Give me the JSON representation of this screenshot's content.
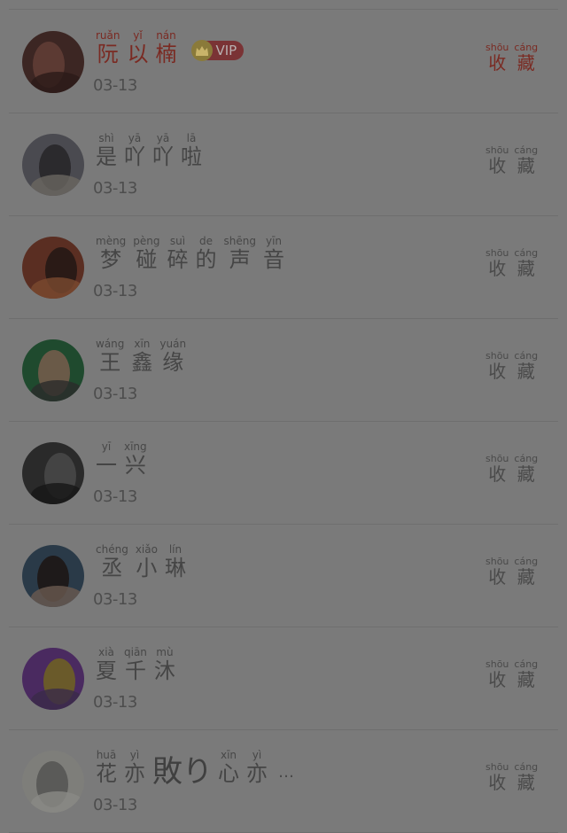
{
  "collect_label": {
    "chars": [
      "收",
      "藏"
    ],
    "pinyin": [
      "shōu",
      "cáng"
    ]
  },
  "vip_label": "VIP",
  "users": [
    {
      "chars": [
        "阮",
        "以",
        "楠"
      ],
      "pinyin": [
        "ruǎn",
        "yǐ",
        "nán"
      ],
      "date": "03-13",
      "vip": true,
      "avatar_colors": [
        "#3c2623",
        "#5c3a33",
        "#2a1a18"
      ]
    },
    {
      "chars": [
        "是",
        "吖",
        "吖",
        "啦"
      ],
      "pinyin": [
        "shì",
        "yā",
        "yā",
        "lā"
      ],
      "date": "03-13",
      "vip": false,
      "avatar_colors": [
        "#4a4a50",
        "#2b2a2d",
        "#6a6660"
      ]
    },
    {
      "chars": [
        "梦",
        "碰",
        "碎",
        "的",
        "声",
        "音"
      ],
      "pinyin": [
        "mèng",
        "pèng",
        "suì",
        "de",
        "shēng",
        "yīn"
      ],
      "date": "03-13",
      "vip": false,
      "avatar_colors": [
        "#5a2e22",
        "#2a1a16",
        "#7a4a30"
      ]
    },
    {
      "chars": [
        "王",
        "鑫",
        "缘"
      ],
      "pinyin": [
        "wáng",
        "xīn",
        "yuán"
      ],
      "date": "03-13",
      "vip": false,
      "avatar_colors": [
        "#1f4a2e",
        "#6a5a48",
        "#2b2b2b"
      ]
    },
    {
      "chars": [
        "一",
        "兴"
      ],
      "pinyin": [
        "yī",
        "xīng"
      ],
      "date": "03-13",
      "vip": false,
      "avatar_colors": [
        "#2a2a2a",
        "#444444",
        "#161616"
      ]
    },
    {
      "chars": [
        "丞",
        "小",
        "琳"
      ],
      "pinyin": [
        "chéng",
        "xiǎo",
        "lín"
      ],
      "date": "03-13",
      "vip": false,
      "avatar_colors": [
        "#2a3a48",
        "#1e1a1a",
        "#6a5a50"
      ]
    },
    {
      "chars": [
        "夏",
        "千",
        "沐"
      ],
      "pinyin": [
        "xià",
        "qiān",
        "mù"
      ],
      "date": "03-13",
      "vip": false,
      "avatar_colors": [
        "#4a2a60",
        "#6a5a2a",
        "#3a2a48"
      ]
    },
    {
      "chars": [
        "花",
        "亦"
      ],
      "pinyin": [
        "huā",
        "yì"
      ],
      "mid_text": "敗り",
      "chars2": [
        "心",
        "亦"
      ],
      "pinyin2": [
        "xīn",
        "yì"
      ],
      "ellipsis": "…",
      "date": "03-13",
      "vip": false,
      "avatar_colors": [
        "#7e7e7a",
        "#5a5a58",
        "#8a8a86"
      ]
    }
  ]
}
